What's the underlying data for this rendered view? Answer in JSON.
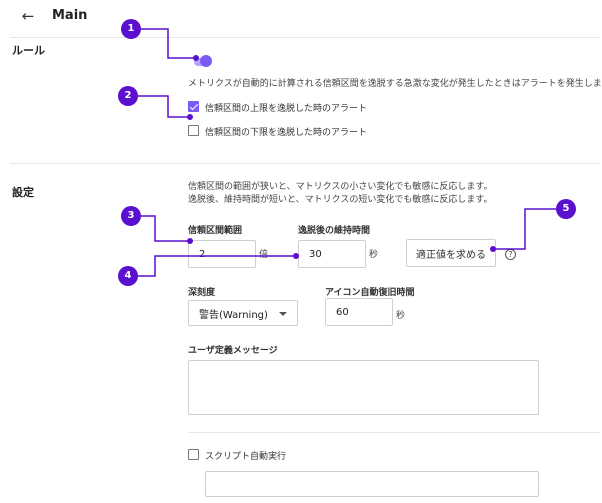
{
  "header": {
    "back_icon": "arrow-left-icon",
    "title": "Main"
  },
  "rules": {
    "heading": "ルール",
    "toggle_on": true,
    "description": "メトリクスが自動的に計算される信頼区間を逸脱する急激な変化が発生したときはアラートを発生します。",
    "upper": {
      "label": "信頼区間の上限を逸脱した時のアラート",
      "checked": true
    },
    "lower": {
      "label": "信頼区間の下限を逸脱した時のアラート",
      "checked": false
    }
  },
  "settings": {
    "heading": "設定",
    "desc_line1": "信頼区間の範囲が狭いと、マトリクスの小さい変化でも敏感に反応します。",
    "desc_line2": "逸脱後、維持時間が短いと、マトリクスの短い変化でも敏感に反応します。",
    "range_label": "信頼区間範囲",
    "range_value": "2",
    "range_unit": "倍",
    "duration_label": "逸脱後の維持時間",
    "duration_value": "30",
    "duration_unit": "秒",
    "optimize_button": "適正値を求める",
    "help_icon": "question-circle-icon",
    "help_glyph": "?",
    "severity_label": "深刻度",
    "severity_value": "警告(Warning)",
    "recovery_label": "アイコン自動復旧時間",
    "recovery_value": "60",
    "recovery_unit": "秒",
    "message_label": "ユーザ定義メッセージ",
    "message_value": "",
    "script_label": "スクリプト自動実行",
    "script_checked": false,
    "script_value": ""
  },
  "annotations": {
    "color": "#5b0fcf",
    "badges": [
      "1",
      "2",
      "3",
      "4",
      "5"
    ]
  }
}
